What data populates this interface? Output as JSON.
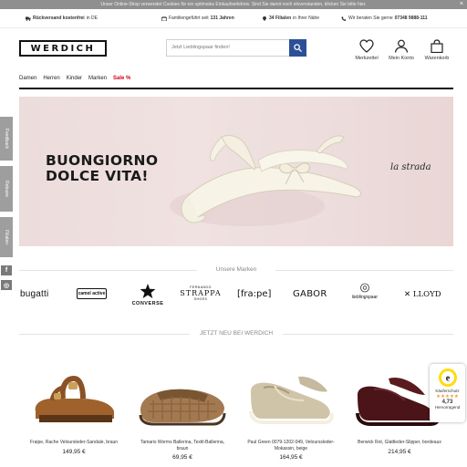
{
  "cookie_banner": {
    "text": "Unser Online-Shop verwendet Cookies für ein optimales Einkaufserlebnis. Sind Sie damit noch einverstanden, klicken Sie bitte hier.",
    "close": "×"
  },
  "usp": {
    "shipping_bold": "Rückversand kostenfrei",
    "shipping_rest": "in DE",
    "family": "Familiengeführt seit",
    "family_bold": "131 Jahren",
    "stores_bold": "34 Filialen",
    "stores_rest": "in Ihrer Nähe",
    "phone": "Wir beraten Sie gerne",
    "phone_bold": "07348 9888-111"
  },
  "header": {
    "logo": "WERDICH",
    "search_placeholder": "Jetzt Lieblingspaar finden!",
    "wishlist": "Merkzettel",
    "account": "Mein Konto",
    "cart": "Warenkorb"
  },
  "nav": [
    "Damen",
    "Herren",
    "Kinder",
    "Marken",
    "Sale %"
  ],
  "hero": {
    "line1": "BUONGIORNO",
    "line2": "DOLCE VITA!",
    "brand": "la strada"
  },
  "side_tabs": [
    "Feedback",
    "Retoure",
    "Filialen"
  ],
  "social": [
    "f",
    "◎"
  ],
  "brands_section": {
    "title": "Unsere Marken",
    "brands": [
      "bugatti",
      "camel active",
      "CONVERSE",
      "STRAPPA",
      "[fra:pe]",
      "GABOR",
      "lieblingspaar",
      "LLOYD"
    ],
    "strappa_top": "FERNANDO",
    "strappa_bottom": "SHOES"
  },
  "new_section": {
    "title": "JETZT NEU BEI WERDICH",
    "products": [
      {
        "name": "Fraipe, Rache Veloursleder-Sandale, braun",
        "price": "149,95 €"
      },
      {
        "name": "Tamaris Worms Ballerina, Textil-Ballerina, braun",
        "price": "69,95 €"
      },
      {
        "name": "Paul Green 0079-1202-049, Velourssleder-Mokassin, beige",
        "price": "164,95 €"
      },
      {
        "name": "Berwick Rot, Glattleder-Slipper, bordeaux",
        "price": "214,95 €"
      }
    ]
  },
  "trust": {
    "label": "Käuferschutz",
    "stars": "★★★★★",
    "rating": "4,73",
    "grade": "Hervorragend"
  },
  "colors": {
    "accent_blue": "#2c4f98",
    "sale_red": "#d0021b",
    "hero_bg": "#eddddd",
    "tab_grey": "#9e9e9e"
  }
}
